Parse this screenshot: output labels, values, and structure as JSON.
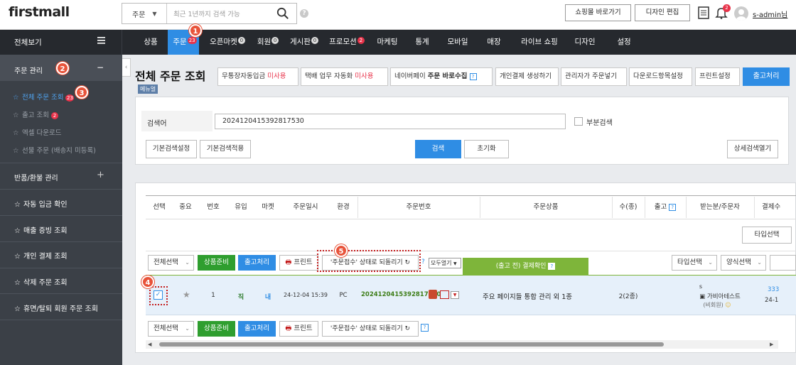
{
  "header": {
    "logo": "firstmall",
    "search_select": "주문",
    "search_placeholder": "최근 1년까지 검색 가능",
    "help": "?",
    "shop_button": "쇼핑몰 바로가기",
    "design_button": "디자인 편집",
    "bell_count": "2",
    "user": "s-admin님"
  },
  "nav": {
    "sidebar_title": "전체보기",
    "items": [
      {
        "label": "상품",
        "badge": ""
      },
      {
        "label": "주문",
        "badge": "23"
      },
      {
        "label": "오픈마켓",
        "badge": "0"
      },
      {
        "label": "회원",
        "badge": "0"
      },
      {
        "label": "게시판",
        "badge": "0"
      },
      {
        "label": "프로모션",
        "badge": "2"
      },
      {
        "label": "마케팅",
        "badge": ""
      },
      {
        "label": "통계",
        "badge": ""
      },
      {
        "label": "모바일",
        "badge": ""
      },
      {
        "label": "매장",
        "badge": ""
      },
      {
        "label": "라이브 쇼핑",
        "badge": ""
      },
      {
        "label": "디자인",
        "badge": ""
      },
      {
        "label": "설정",
        "badge": ""
      }
    ]
  },
  "sidebar": {
    "section": "주문 관리",
    "collapse": "−",
    "subitems": [
      {
        "label": "전체 주문 조회",
        "badge": "23"
      },
      {
        "label": "출고 조회",
        "badge": "2"
      },
      {
        "label": "엑셀 다운로드",
        "badge": ""
      },
      {
        "label": "선물 주문 (배송지 미등록)",
        "badge": ""
      }
    ],
    "return_section": "반품/환불 관리",
    "plus": "+",
    "items": [
      "자동 입금 확인",
      "매출 증빙 조회",
      "개인 결제 조회",
      "삭제 주문 조회",
      "휴면/탈퇴 회원 주문 조회"
    ]
  },
  "page": {
    "title": "전체 주문 조회",
    "manual": "메뉴얼",
    "toolbar": {
      "deposit": "무통장자동입금",
      "deposit_status": "미사용",
      "courier": "택배 업무 자동화",
      "courier_status": "미사용",
      "naverpay": "네이버페이",
      "naverpay_bold": "주문 바로수집",
      "personal_pay": "개인결제 생성하기",
      "admin_order": "관리자가 주문넣기",
      "download_settings": "다운로드항목설정",
      "print_settings": "프린트설정",
      "ship": "출고처리"
    },
    "search": {
      "label": "검색어",
      "value": "2024120415392817530",
      "partial": "부분검색",
      "basic_settings": "기본검색설정",
      "basic_apply": "기본검색적용",
      "search": "검색",
      "reset": "초기화",
      "advanced": "상세검색열기"
    },
    "table": {
      "headers": [
        "선택",
        "중요",
        "번호",
        "유입",
        "마켓",
        "주문일시",
        "환경",
        "주문번호",
        "주문상품",
        "수(종)",
        "출고",
        "받는분/주문자",
        "결제수"
      ],
      "type_select": "타입선택",
      "actions": {
        "select_all": "전체선택",
        "prepare": "상품준비",
        "ship": "출고처리",
        "print": "프린트",
        "revert": "'주문접수' 상태로 되돌리기",
        "open_all": "모두열기",
        "pre_ship": "(출고 전) 결제확인",
        "type_select": "타입선택",
        "style_select": "양식선택"
      },
      "row": {
        "no": "1",
        "inflow": "직",
        "market": "내",
        "date": "24-12-04 15:39",
        "env": "PC",
        "order_no": "2024120415392817530",
        "product": "주요 페이지들 통합 관리 외 1종",
        "qty": "2(2종)",
        "recipient_1": "s",
        "recipient_2": "가비아테스트",
        "recipient_3": "(비회원)",
        "pay_1": "333",
        "pay_2": "24-1"
      }
    }
  },
  "markers": [
    "1",
    "2",
    "3",
    "4",
    "5"
  ],
  "colors": {
    "accent": "#2f8de4",
    "green": "#2f9e2f",
    "marker": "#e8533a",
    "nav_bg": "#26292e",
    "sidebar_bg": "#3b4047"
  }
}
